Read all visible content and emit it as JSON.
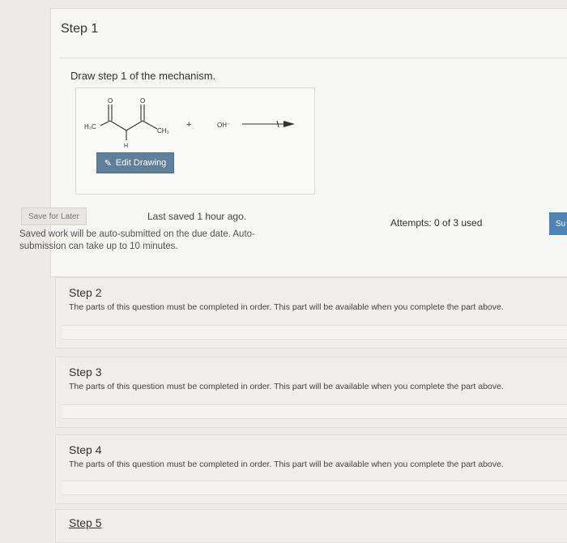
{
  "step1": {
    "title": "Step 1",
    "prompt": "Draw step 1 of the mechanism.",
    "edit_button_label": "Edit Drawing",
    "save_button_label": "Save for Later",
    "last_saved": "Last saved 1 hour ago.",
    "autosave_note": "Saved work will be auto-submitted on the due date. Auto-submission can take up to 10 minutes.",
    "attempts": "Attempts: 0 of 3 used",
    "submit_label": "Su"
  },
  "molecule": {
    "left_group": "H₃C",
    "right_group": "CH₃",
    "h_label": "H",
    "o1": "O",
    "o2": "O",
    "plus": "+",
    "hydroxide": "OH⁻"
  },
  "steps": [
    {
      "title": "Step 2",
      "message": "The parts of this question must be completed in order. This part will be available when you complete the part above."
    },
    {
      "title": "Step 3",
      "message": "The parts of this question must be completed in order. This part will be available when you complete the part above."
    },
    {
      "title": "Step 4",
      "message": "The parts of this question must be completed in order. This part will be available when you complete the part above."
    },
    {
      "title": "Step 5",
      "message": ""
    }
  ]
}
